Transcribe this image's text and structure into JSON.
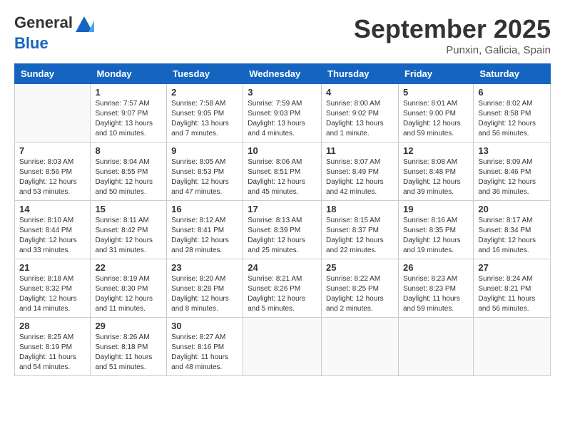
{
  "logo": {
    "general": "General",
    "blue": "Blue"
  },
  "title": "September 2025",
  "location": "Punxin, Galicia, Spain",
  "headers": [
    "Sunday",
    "Monday",
    "Tuesday",
    "Wednesday",
    "Thursday",
    "Friday",
    "Saturday"
  ],
  "weeks": [
    [
      {
        "day": "",
        "info": ""
      },
      {
        "day": "1",
        "info": "Sunrise: 7:57 AM\nSunset: 9:07 PM\nDaylight: 13 hours\nand 10 minutes."
      },
      {
        "day": "2",
        "info": "Sunrise: 7:58 AM\nSunset: 9:05 PM\nDaylight: 13 hours\nand 7 minutes."
      },
      {
        "day": "3",
        "info": "Sunrise: 7:59 AM\nSunset: 9:03 PM\nDaylight: 13 hours\nand 4 minutes."
      },
      {
        "day": "4",
        "info": "Sunrise: 8:00 AM\nSunset: 9:02 PM\nDaylight: 13 hours\nand 1 minute."
      },
      {
        "day": "5",
        "info": "Sunrise: 8:01 AM\nSunset: 9:00 PM\nDaylight: 12 hours\nand 59 minutes."
      },
      {
        "day": "6",
        "info": "Sunrise: 8:02 AM\nSunset: 8:58 PM\nDaylight: 12 hours\nand 56 minutes."
      }
    ],
    [
      {
        "day": "7",
        "info": "Sunrise: 8:03 AM\nSunset: 8:56 PM\nDaylight: 12 hours\nand 53 minutes."
      },
      {
        "day": "8",
        "info": "Sunrise: 8:04 AM\nSunset: 8:55 PM\nDaylight: 12 hours\nand 50 minutes."
      },
      {
        "day": "9",
        "info": "Sunrise: 8:05 AM\nSunset: 8:53 PM\nDaylight: 12 hours\nand 47 minutes."
      },
      {
        "day": "10",
        "info": "Sunrise: 8:06 AM\nSunset: 8:51 PM\nDaylight: 12 hours\nand 45 minutes."
      },
      {
        "day": "11",
        "info": "Sunrise: 8:07 AM\nSunset: 8:49 PM\nDaylight: 12 hours\nand 42 minutes."
      },
      {
        "day": "12",
        "info": "Sunrise: 8:08 AM\nSunset: 8:48 PM\nDaylight: 12 hours\nand 39 minutes."
      },
      {
        "day": "13",
        "info": "Sunrise: 8:09 AM\nSunset: 8:46 PM\nDaylight: 12 hours\nand 36 minutes."
      }
    ],
    [
      {
        "day": "14",
        "info": "Sunrise: 8:10 AM\nSunset: 8:44 PM\nDaylight: 12 hours\nand 33 minutes."
      },
      {
        "day": "15",
        "info": "Sunrise: 8:11 AM\nSunset: 8:42 PM\nDaylight: 12 hours\nand 31 minutes."
      },
      {
        "day": "16",
        "info": "Sunrise: 8:12 AM\nSunset: 8:41 PM\nDaylight: 12 hours\nand 28 minutes."
      },
      {
        "day": "17",
        "info": "Sunrise: 8:13 AM\nSunset: 8:39 PM\nDaylight: 12 hours\nand 25 minutes."
      },
      {
        "day": "18",
        "info": "Sunrise: 8:15 AM\nSunset: 8:37 PM\nDaylight: 12 hours\nand 22 minutes."
      },
      {
        "day": "19",
        "info": "Sunrise: 8:16 AM\nSunset: 8:35 PM\nDaylight: 12 hours\nand 19 minutes."
      },
      {
        "day": "20",
        "info": "Sunrise: 8:17 AM\nSunset: 8:34 PM\nDaylight: 12 hours\nand 16 minutes."
      }
    ],
    [
      {
        "day": "21",
        "info": "Sunrise: 8:18 AM\nSunset: 8:32 PM\nDaylight: 12 hours\nand 14 minutes."
      },
      {
        "day": "22",
        "info": "Sunrise: 8:19 AM\nSunset: 8:30 PM\nDaylight: 12 hours\nand 11 minutes."
      },
      {
        "day": "23",
        "info": "Sunrise: 8:20 AM\nSunset: 8:28 PM\nDaylight: 12 hours\nand 8 minutes."
      },
      {
        "day": "24",
        "info": "Sunrise: 8:21 AM\nSunset: 8:26 PM\nDaylight: 12 hours\nand 5 minutes."
      },
      {
        "day": "25",
        "info": "Sunrise: 8:22 AM\nSunset: 8:25 PM\nDaylight: 12 hours\nand 2 minutes."
      },
      {
        "day": "26",
        "info": "Sunrise: 8:23 AM\nSunset: 8:23 PM\nDaylight: 11 hours\nand 59 minutes."
      },
      {
        "day": "27",
        "info": "Sunrise: 8:24 AM\nSunset: 8:21 PM\nDaylight: 11 hours\nand 56 minutes."
      }
    ],
    [
      {
        "day": "28",
        "info": "Sunrise: 8:25 AM\nSunset: 8:19 PM\nDaylight: 11 hours\nand 54 minutes."
      },
      {
        "day": "29",
        "info": "Sunrise: 8:26 AM\nSunset: 8:18 PM\nDaylight: 11 hours\nand 51 minutes."
      },
      {
        "day": "30",
        "info": "Sunrise: 8:27 AM\nSunset: 8:16 PM\nDaylight: 11 hours\nand 48 minutes."
      },
      {
        "day": "",
        "info": ""
      },
      {
        "day": "",
        "info": ""
      },
      {
        "day": "",
        "info": ""
      },
      {
        "day": "",
        "info": ""
      }
    ]
  ]
}
